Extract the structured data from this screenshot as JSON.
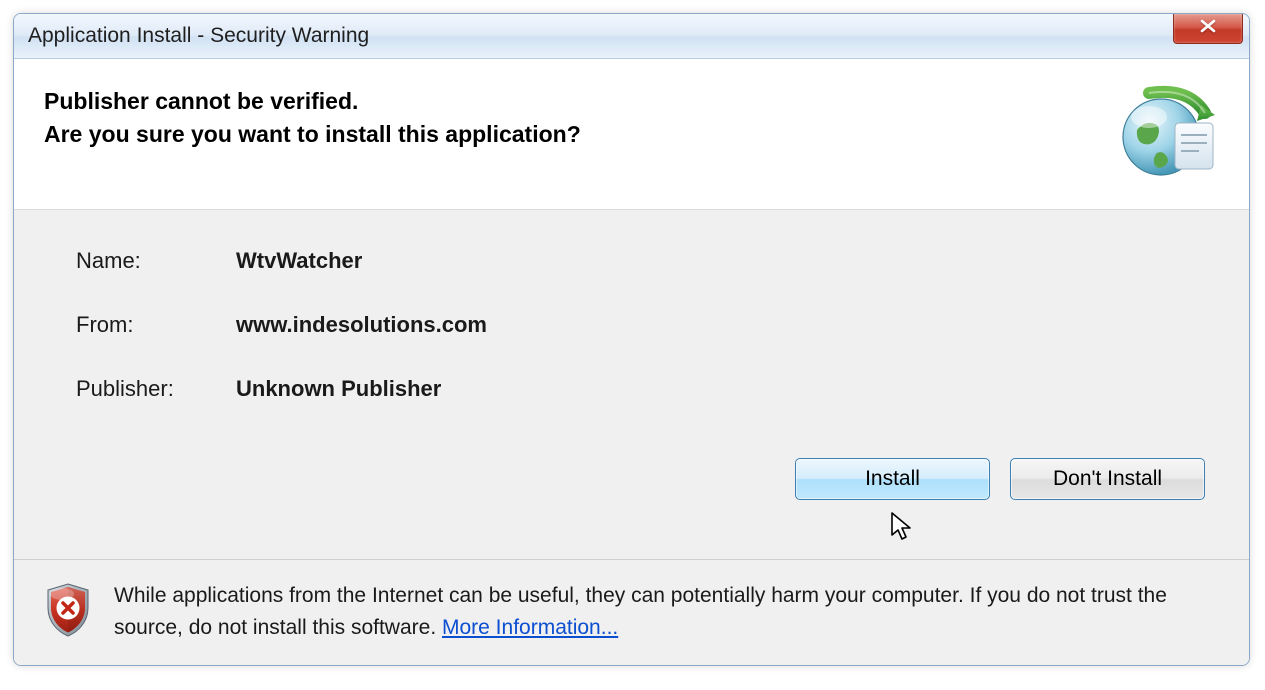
{
  "titlebar": {
    "title": "Application Install - Security Warning"
  },
  "header": {
    "line1": "Publisher cannot be verified.",
    "line2": "Are you sure you want to install this application?"
  },
  "info": {
    "name_label": "Name:",
    "name_value": "WtvWatcher",
    "from_label": "From:",
    "from_value": "www.indesolutions.com",
    "publisher_label": "Publisher:",
    "publisher_value": "Unknown Publisher"
  },
  "buttons": {
    "install": "Install",
    "dont_install": "Don't Install"
  },
  "footer": {
    "warning_text": "While applications from the Internet can be useful, they can potentially harm your computer. If you do not trust the source, do not install this software. ",
    "more_info": "More Information..."
  }
}
